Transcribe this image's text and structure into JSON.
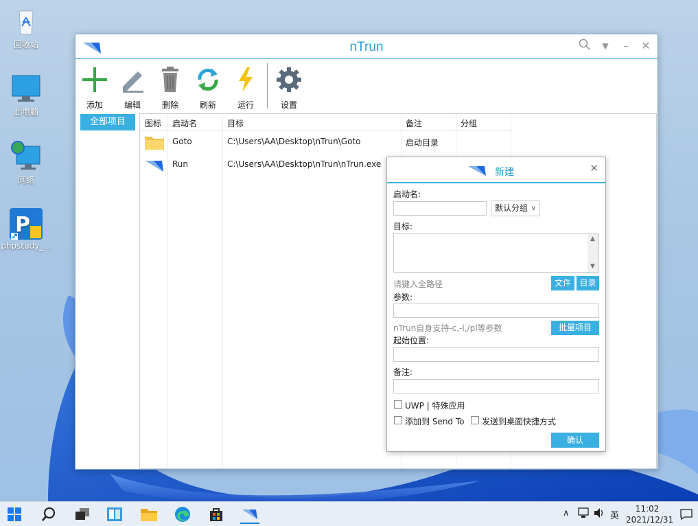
{
  "desktop": {
    "icons": [
      {
        "label": "回收站"
      },
      {
        "label": "此电脑"
      },
      {
        "label": "网络"
      },
      {
        "label": "phpstudy_..."
      }
    ]
  },
  "window": {
    "title": "nTrun",
    "toolbar": {
      "add": "添加",
      "edit": "编辑",
      "delete": "删除",
      "refresh": "刷新",
      "run": "运行",
      "settings": "设置"
    },
    "sidebar": {
      "all_items": "全部项目"
    },
    "table": {
      "headers": {
        "icon": "图标",
        "name": "启动名",
        "target": "目标",
        "note": "备注",
        "group": "分组"
      },
      "rows": [
        {
          "name": "Goto",
          "target": "C:\\Users\\AA\\Desktop\\nTrun\\Goto",
          "note": "启动目录",
          "group": ""
        },
        {
          "name": "Run",
          "target": "C:\\Users\\AA\\Desktop\\nTrun\\nTrun.exe",
          "note": "",
          "group": ""
        }
      ]
    }
  },
  "dialog": {
    "title": "新建",
    "name_label": "启动名:",
    "name_value": "",
    "group_select": "默认分组",
    "target_label": "目标:",
    "target_value": "",
    "target_hint": "请键入全路径",
    "file_button": "文件",
    "dir_button": "目录",
    "params_label": "参数:",
    "params_value": "",
    "params_hint": "nTrun自身支持-c,-l,/pl等参数",
    "batch_button": "批量项目",
    "startdir_label": "起始位置:",
    "startdir_value": "",
    "note_label": "备注:",
    "note_value": "",
    "uwp_label": "UWP | 特殊应用",
    "sendto_label": "添加到 Send To",
    "shortcut_label": "发送到桌面快捷方式",
    "confirm_button": "确认"
  },
  "taskbar": {
    "ime": "英",
    "time": "11:02",
    "date": "2021/12/31"
  }
}
